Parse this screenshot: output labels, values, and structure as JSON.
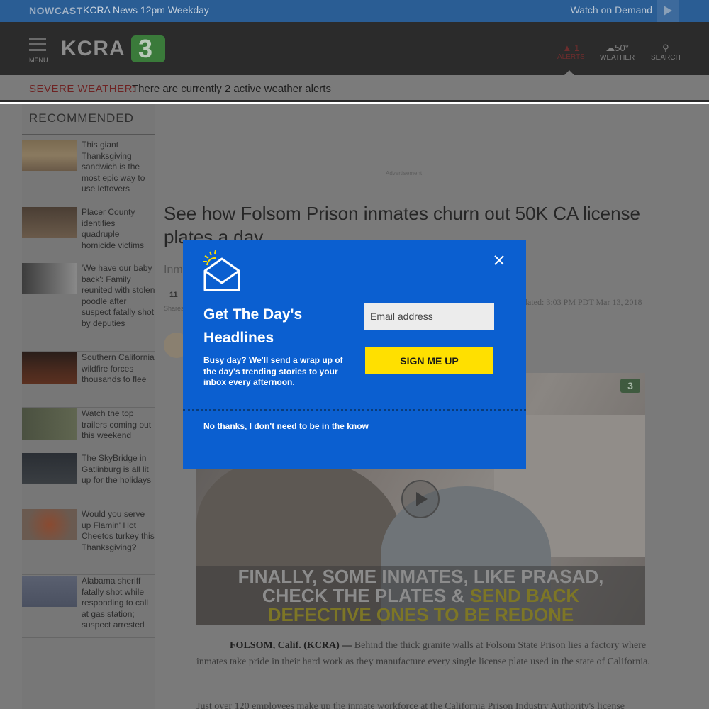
{
  "nowcast": {
    "label": "NOWCAST",
    "show": "KCRA News 12pm Weekday",
    "watch_label": "Watch on Demand"
  },
  "header": {
    "menu_label": "MENU",
    "logo_text": "KCRA",
    "logo_number": "3",
    "alerts_count": "1",
    "alerts_label": "ALERTS",
    "weather_temp": "50°",
    "weather_label": "WEATHER",
    "search_label": "SEARCH"
  },
  "severe_weather": {
    "label": "SEVERE WEATHER:",
    "message": "There are currently 2 active weather alerts"
  },
  "sidebar": {
    "heading": "RECOMMENDED",
    "items": [
      {
        "title": "This giant Thanksgiving sandwich is the most epic way to use leftovers"
      },
      {
        "title": "Placer County identifies quadruple homicide victims"
      },
      {
        "title": "'We have our baby back': Family reunited with stolen poodle after suspect fatally shot by deputies"
      },
      {
        "title": "Southern California wildfire forces thousands to flee"
      },
      {
        "title": "Watch the top trailers coming out this weekend"
      },
      {
        "title": "The SkyBridge in Gatlinburg is all lit up for the holidays"
      },
      {
        "title": "Would you serve up Flamin' Hot Cheetos turkey this Thanksgiving?"
      },
      {
        "title": "Alabama sheriff fatally shot while responding to call at gas station; suspect arrested"
      }
    ]
  },
  "article": {
    "advertisement_label": "Advertisement",
    "headline": "See how Folsom Prison inmates churn out 50K CA license plates a day",
    "subline_visible": "Inm",
    "share_count": "11",
    "share_label": "Shares",
    "updated": "dated: 3:03 PM PDT Mar 13, 2018",
    "video": {
      "logo": "3",
      "caption_line1": "FINALLY, SOME INMATES, LIKE PRASAD,",
      "caption_line2_a": "CHECK THE PLATES & ",
      "caption_line2_b": "SEND BACK",
      "caption_line3": "DEFECTIVE ONES TO BE REDONE"
    },
    "dateline": "FOLSOM, Calif. (KCRA) —",
    "paragraph1": " Behind the thick granite walls at Folsom State Prison lies a factory where inmates take pride in their hard work as they manufacture every single license plate used in the state of California.",
    "paragraph2": "Just over 120 employees make up the inmate workforce at the California Prison Industry Authority's license"
  },
  "modal": {
    "title": "Get The Day's Headlines",
    "description": "Busy day? We'll send a wrap up of the day's trending stories to your inbox every afternoon.",
    "email_placeholder": "Email address",
    "submit_label": "SIGN ME UP",
    "decline_label": "No thanks, I don't need to be in the know"
  },
  "colors": {
    "modal_bg": "#0b5fd0",
    "submit_bg": "#ffe000",
    "nowcast_bg": "#2a5d94"
  }
}
